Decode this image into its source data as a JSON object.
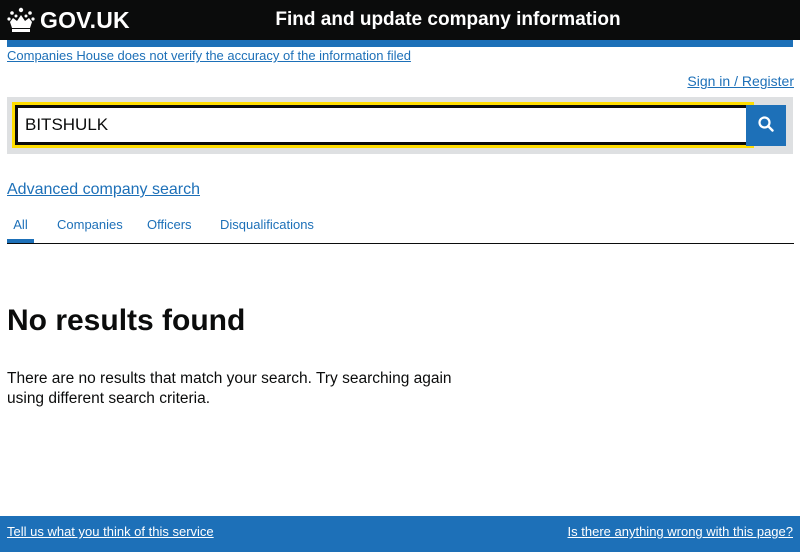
{
  "header": {
    "logo_text": "GOV.UK",
    "service_name": "Find and update company information"
  },
  "notice": {
    "disclaimer": "Companies House does not verify the accuracy of the information filed"
  },
  "account": {
    "signin_label": "Sign in / Register"
  },
  "search": {
    "value": "BITSHULK",
    "button_icon": "search-icon"
  },
  "advanced_search": {
    "label": "Advanced company search"
  },
  "tabs": [
    {
      "label": "All",
      "selected": true
    },
    {
      "label": "Companies",
      "selected": false
    },
    {
      "label": "Officers",
      "selected": false
    },
    {
      "label": "Disqualifications",
      "selected": false
    }
  ],
  "results": {
    "heading": "No results found",
    "message": "There are no results that match your search. Try searching again using different search criteria."
  },
  "footer": {
    "feedback_label": "Tell us what you think of this service",
    "report_label": "Is there anything wrong with this page?"
  },
  "colors": {
    "header_bg": "#0b0c0c",
    "accent_blue": "#1d70b8",
    "focus_yellow": "#ffdd00",
    "search_bg": "#dee0e2"
  }
}
